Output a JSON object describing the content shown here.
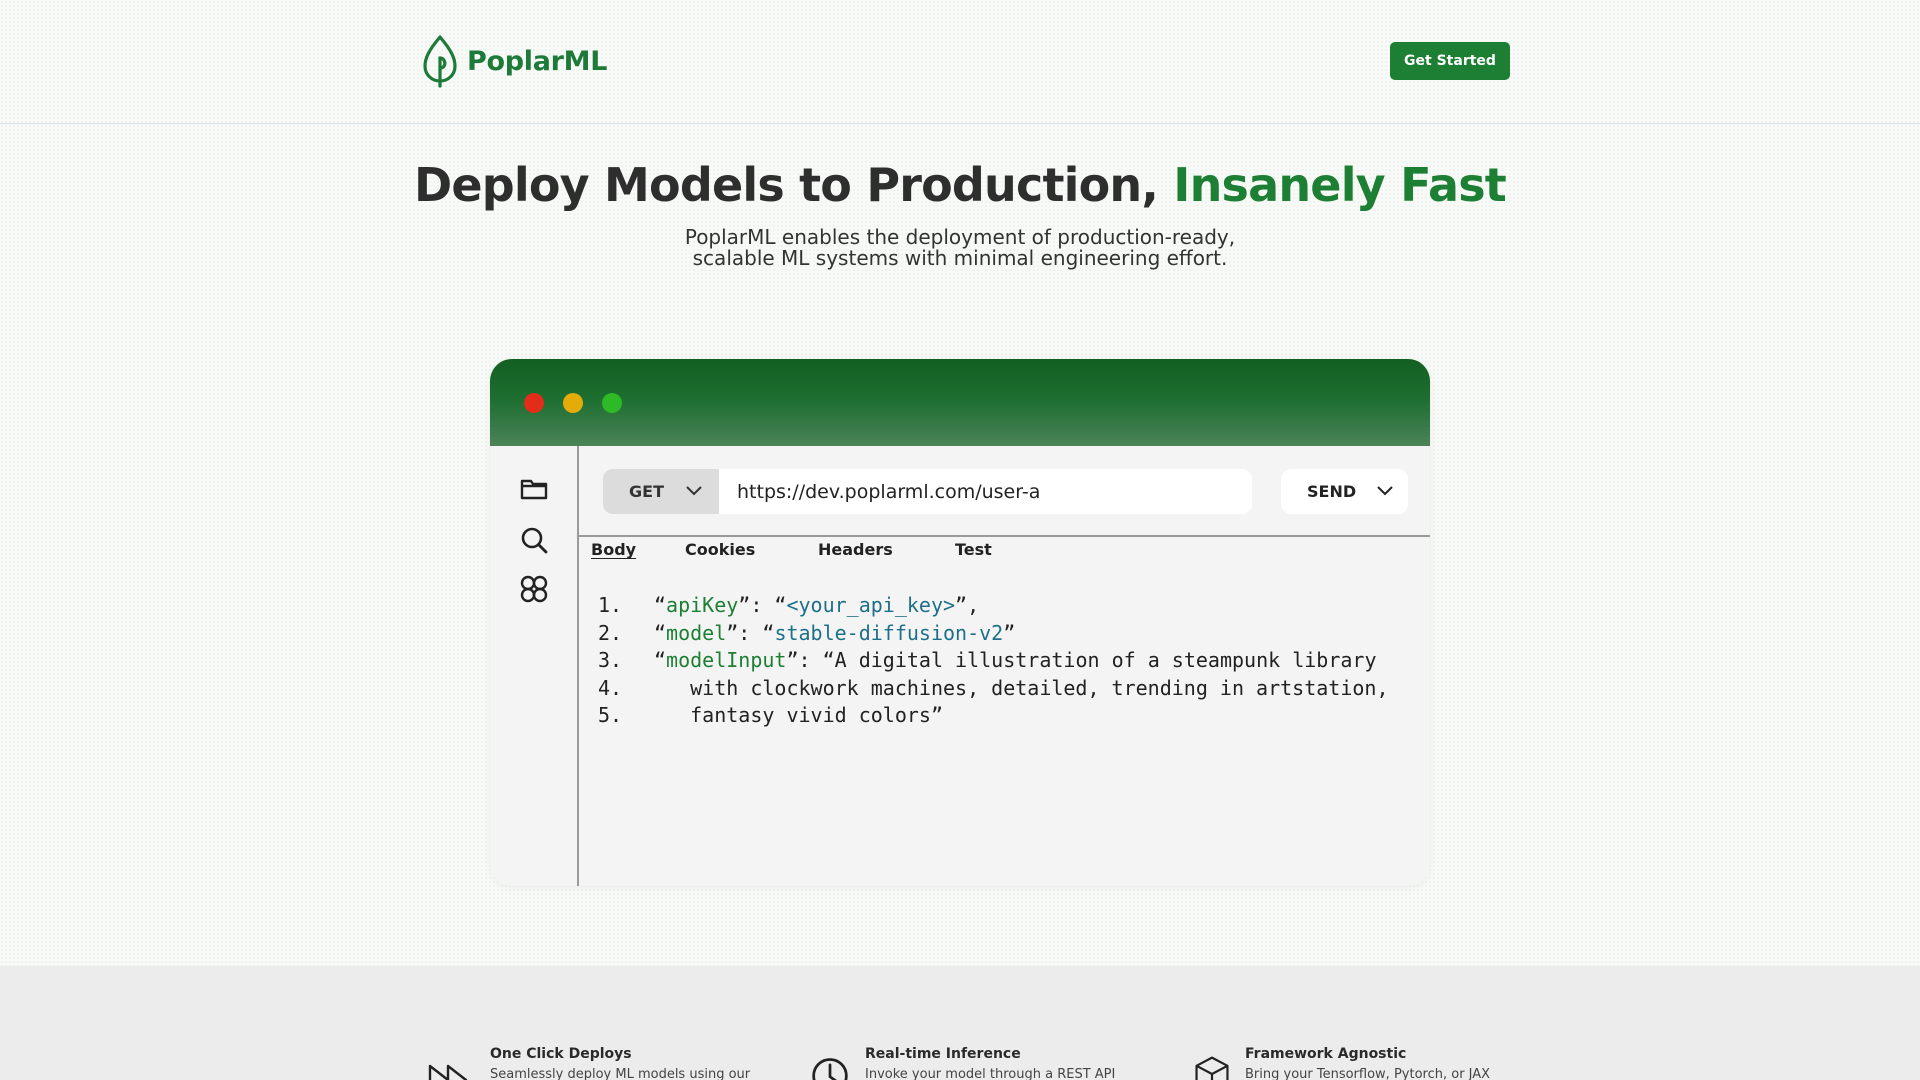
{
  "brand": {
    "name": "PoplarML",
    "color": "#1c7f33"
  },
  "header": {
    "cta_label": "Get Started"
  },
  "hero": {
    "title_main": "Deploy Models to Production, ",
    "title_accent": "Insanely Fast",
    "subtitle_line1": "PoplarML enables the deployment of production-ready,",
    "subtitle_line2": "scalable ML systems with minimal engineering effort."
  },
  "window": {
    "controls": [
      "close",
      "minimize",
      "maximize"
    ],
    "sidebar_icons": [
      "folder-icon",
      "search-icon",
      "apps-icon"
    ],
    "request": {
      "method": "GET",
      "url": "https://dev.poplarml.com/user-a",
      "send_label": "SEND"
    },
    "tabs": [
      {
        "label": "Body",
        "active": true
      },
      {
        "label": "Cookies",
        "active": false
      },
      {
        "label": "Headers",
        "active": false
      },
      {
        "label": "Test",
        "active": false
      }
    ],
    "code": {
      "line1": {
        "num": "1.",
        "q_open": "“",
        "key": "apiKey",
        "sep": "”: “",
        "value": "<your_api_key>",
        "tail": "”,"
      },
      "line2": {
        "num": "2.",
        "q_open": "“",
        "key": "model",
        "sep": "”: “",
        "value": "stable-diffusion-v2",
        "tail": "”"
      },
      "line3": {
        "num": "3.",
        "q_open": "“",
        "key": "modelInput",
        "text": "”: “A digital illustration of a steampunk library"
      },
      "line4": {
        "num": "4.",
        "text": "   with clockwork machines, detailed, trending in artstation,"
      },
      "line5": {
        "num": "5.",
        "text": "   fantasy vivid colors”"
      }
    }
  },
  "features": [
    {
      "icon": "fast-forward-icon",
      "title": "One Click Deploys",
      "desc": "Seamlessly deploy ML models using our"
    },
    {
      "icon": "clock-icon",
      "title": "Real-time Inference",
      "desc": "Invoke your model through a REST API"
    },
    {
      "icon": "cube-icon",
      "title": "Framework Agnostic",
      "desc": "Bring your Tensorflow, Pytorch, or JAX"
    }
  ]
}
